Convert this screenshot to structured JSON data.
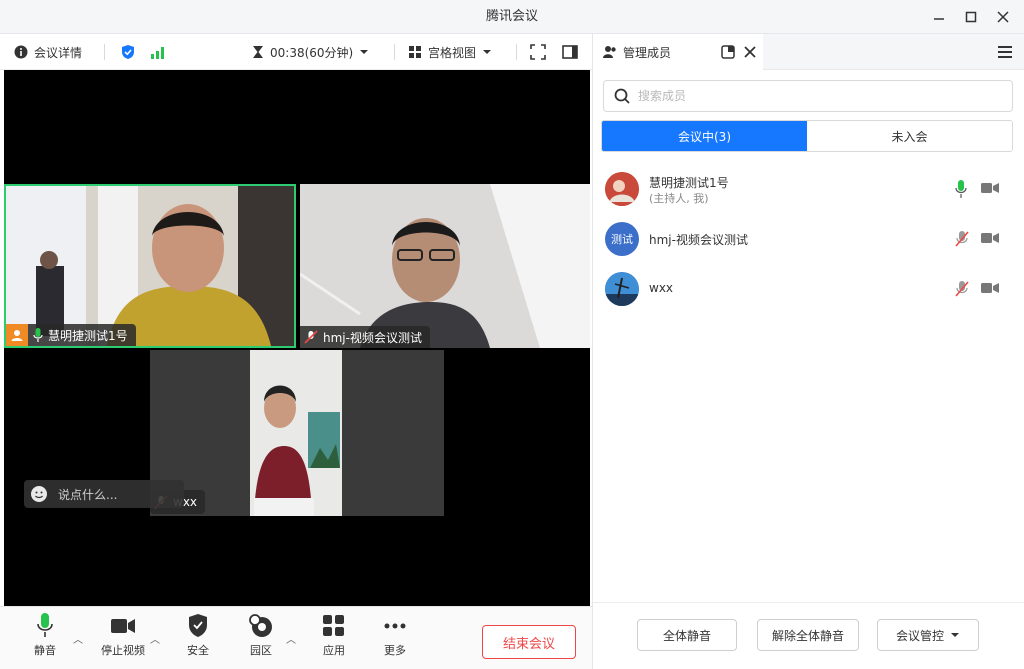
{
  "window": {
    "title": "腾讯会议",
    "minimize_icon": "minimize-icon",
    "maximize_icon": "maximize-icon",
    "close_icon": "close-icon"
  },
  "toolbar": {
    "meeting_details": "会议详情",
    "timer": "00:38(60分钟)",
    "view_mode": "宫格视图"
  },
  "video": {
    "tiles": [
      {
        "name": "慧明捷测试1号",
        "active_speaker": true
      },
      {
        "name": "hmj-视频会议测试"
      },
      {
        "name": "wxx"
      }
    ],
    "chat_placeholder": "说点什么..."
  },
  "controls": {
    "mute": "静音",
    "stop_video": "停止视频",
    "security": "安全",
    "rooms": "园区",
    "apps": "应用",
    "more": "更多",
    "end_meeting": "结束会议"
  },
  "panel": {
    "tab_label": "管理成员",
    "search_placeholder": "搜索成员",
    "tabs": {
      "in_meeting": "会议中(3)",
      "not_joined": "未入会"
    },
    "members": [
      {
        "name": "慧明捷测试1号",
        "role": "(主持人, 我)",
        "avatar_text": "",
        "avatar_color": "#c0392b",
        "mic": "on"
      },
      {
        "name": "hmj-视频会议测试",
        "role": "",
        "avatar_text": "测试",
        "avatar_color": "#3b6fc9",
        "mic": "muted"
      },
      {
        "name": "wxx",
        "role": "",
        "avatar_text": "",
        "avatar_color": "#2c6eb5",
        "mic": "muted"
      }
    ],
    "footer": {
      "mute_all": "全体静音",
      "unmute_all": "解除全体静音",
      "meeting_control": "会议管控"
    }
  },
  "colors": {
    "accent": "#1677ff",
    "end_red": "#ef4747",
    "active_speaker_border": "#2ecc71",
    "mic_green": "#27c24c"
  }
}
